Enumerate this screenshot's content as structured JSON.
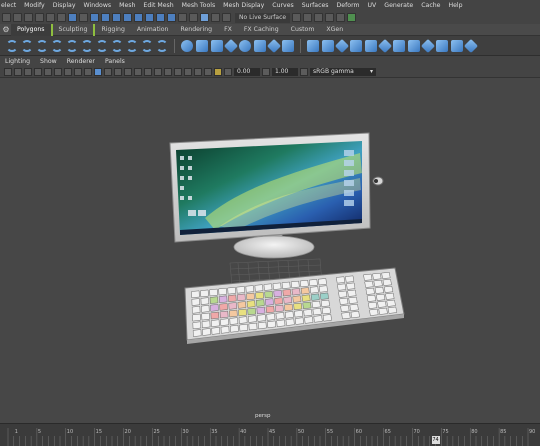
{
  "menu": [
    "elect",
    "Modify",
    "Display",
    "Windows",
    "Mesh",
    "Edit Mesh",
    "Mesh Tools",
    "Mesh Display",
    "Curves",
    "Surfaces",
    "Deform",
    "UV",
    "Generate",
    "Cache",
    "Help"
  ],
  "status": {
    "live_surface": "No Live Surface"
  },
  "shelf_tabs": [
    "Polygons",
    "Sculpting",
    "Rigging",
    "Animation",
    "Rendering",
    "FX",
    "FX Caching",
    "Custom",
    "XGen"
  ],
  "shelf_active_tab": "Polygons",
  "panel_menu": [
    "Lighting",
    "Show",
    "Renderer",
    "Panels"
  ],
  "panel_toolbar": {
    "value1": "0.00",
    "value2": "1.00",
    "color_space": "sRGB gamma"
  },
  "viewport": {
    "camera_label": "persp"
  },
  "timeline": {
    "tick_labels": [
      "1",
      "5",
      "10",
      "15",
      "20",
      "25",
      "30",
      "35",
      "40",
      "45",
      "50",
      "55",
      "60",
      "65",
      "70",
      "75",
      "80",
      "85",
      "90"
    ],
    "current_frame": "74"
  },
  "colors": {
    "accent": "#5a8fd0",
    "shelf_marker": "#8fbf3f",
    "viewport_bg": "#474747"
  }
}
